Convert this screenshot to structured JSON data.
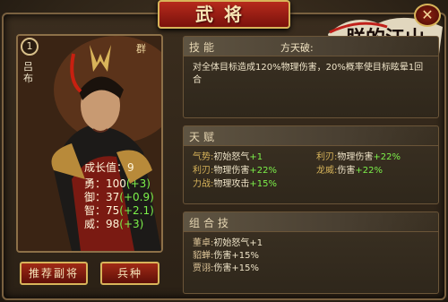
{
  "window": {
    "title": "武将",
    "close_label": "✕"
  },
  "logo": {
    "text": "朕的江山"
  },
  "hero": {
    "level": "1",
    "faction": "群",
    "name": "吕布",
    "growth_label": "成长值：9",
    "stats": [
      {
        "label": "勇：",
        "base": "100",
        "bonus": "(+3)"
      },
      {
        "label": "御：",
        "base": "37",
        "bonus": "(+0.9)"
      },
      {
        "label": "智：",
        "base": "75",
        "bonus": "(+2.1)"
      },
      {
        "label": "威：",
        "base": "98",
        "bonus": "(+3)"
      }
    ]
  },
  "buttons": {
    "recommend": "推荐副将",
    "troops": "兵种"
  },
  "skill": {
    "title": "技能",
    "name": "方天破:",
    "description": "对全体目标造成120%物理伤害，20%概率使目标眩晕1回合"
  },
  "talent": {
    "title": "天赋",
    "items": [
      {
        "key": "气势:",
        "text": "初始怒气",
        "bonus": "+1"
      },
      {
        "key": "利刃:",
        "text": "物理伤害",
        "bonus": "+22%"
      },
      {
        "key": "利刃:",
        "text": "物理伤害",
        "bonus": "+22%"
      },
      {
        "key": "龙威:",
        "text": "伤害",
        "bonus": "+22%"
      },
      {
        "key": "力战:",
        "text": "物理攻击",
        "bonus": "+15%"
      }
    ]
  },
  "combo": {
    "title": "组合技",
    "items": [
      {
        "key": "董卓:",
        "text": "初始怒气+1"
      },
      {
        "key": "貂蝉:",
        "text": "伤害+15%"
      },
      {
        "key": "贾诩:",
        "text": "伤害+15%"
      }
    ]
  },
  "colors": {
    "bonus_green": "#7cf04a",
    "banner_red": "#b62a1c",
    "gold_border": "#d8b45a"
  }
}
